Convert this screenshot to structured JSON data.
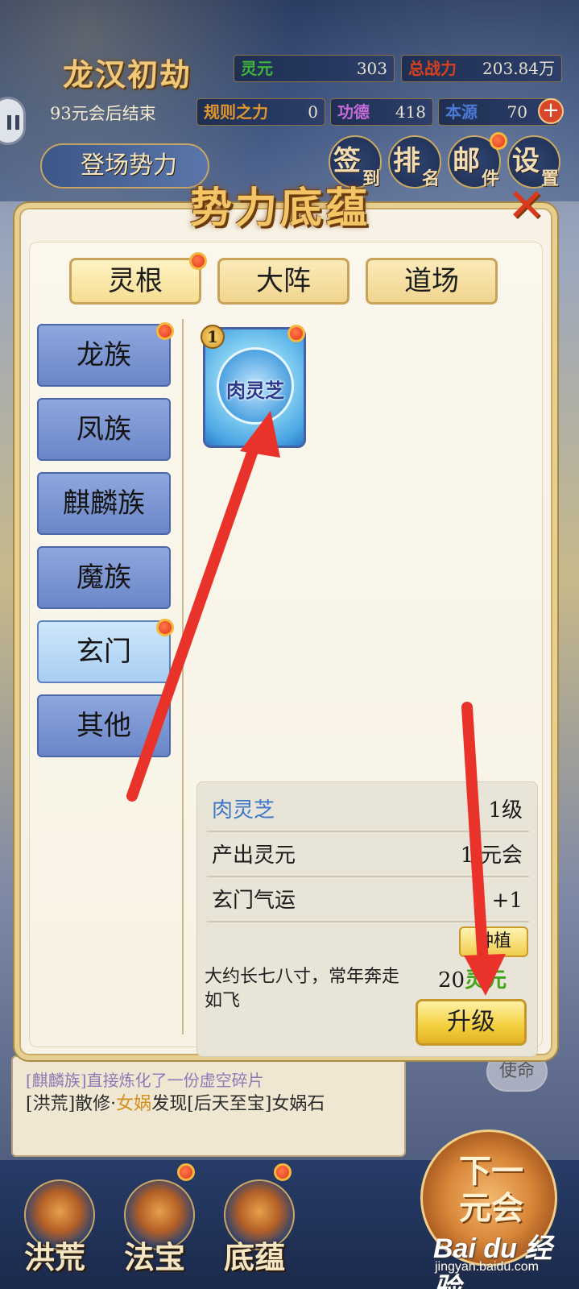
{
  "hud": {
    "era_title": "龙汉初劫",
    "countdown": "93元会后结束",
    "stats": [
      {
        "label": "灵元",
        "value": "303",
        "label_color": "#3fb43a"
      },
      {
        "label": "总战力",
        "value": "203.84万",
        "label_color": "#d8401e"
      },
      {
        "label": "规则之力",
        "value": "0",
        "label_color": "#e0962d"
      },
      {
        "label": "功德",
        "value": "418",
        "label_color": "#c46bd8"
      },
      {
        "label": "本源",
        "value": "70",
        "label_color": "#4c79d6"
      }
    ],
    "plus": "+",
    "faction_button": "登场势力",
    "menu": [
      {
        "big": "签",
        "small": "到",
        "has_dot": false
      },
      {
        "big": "排",
        "small": "名",
        "has_dot": false
      },
      {
        "big": "邮",
        "small": "件",
        "has_dot": true
      },
      {
        "big": "设",
        "small": "置",
        "has_dot": false
      }
    ]
  },
  "modal": {
    "title": "势力底蕴",
    "close": "✕",
    "top_tabs": [
      {
        "label": "灵根",
        "active": true,
        "has_dot": true
      },
      {
        "label": "大阵",
        "active": false,
        "has_dot": false
      },
      {
        "label": "道场",
        "active": false,
        "has_dot": false
      }
    ],
    "side_tabs": [
      {
        "label": "龙族",
        "active": false,
        "has_dot": true
      },
      {
        "label": "凤族",
        "active": false,
        "has_dot": false
      },
      {
        "label": "麒麟族",
        "active": false,
        "has_dot": false
      },
      {
        "label": "魔族",
        "active": false,
        "has_dot": false
      },
      {
        "label": "玄门",
        "active": true,
        "has_dot": true
      },
      {
        "label": "其他",
        "active": false,
        "has_dot": false
      }
    ],
    "item": {
      "level_badge": "1",
      "name": "肉灵芝"
    },
    "detail": {
      "name": "肉灵芝",
      "level": "1级",
      "rows": [
        {
          "label": "产出灵元",
          "value": "1/元会"
        },
        {
          "label": "玄门气运",
          "value": "+1"
        }
      ],
      "plant_button": "种植",
      "description": "大约长七八寸，常年奔走如飞",
      "cost_amount": "20",
      "cost_resource": "灵元",
      "upgrade_button": "升级"
    }
  },
  "log": {
    "line1": "[麒麟族]直接炼化了一份虚空碎片",
    "line2_prefix": "[洪荒]散修·",
    "line2_name": "女娲",
    "line2_suffix": "发现[后天至宝]女娲石"
  },
  "mission_button": "使命",
  "bottom_nav": [
    {
      "label": "洪荒",
      "has_dot": false
    },
    {
      "label": "法宝",
      "has_dot": true
    },
    {
      "label": "底蕴",
      "has_dot": true
    }
  ],
  "next_era": "下一元会",
  "watermark": {
    "logo": "Bai du 经验",
    "url": "jingyan.baidu.com"
  }
}
